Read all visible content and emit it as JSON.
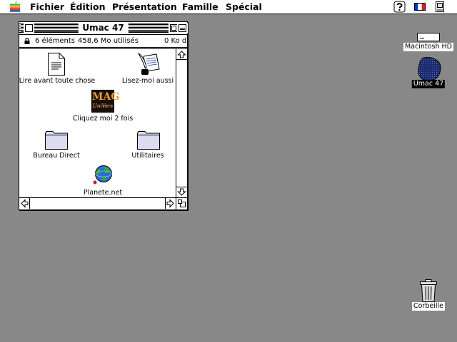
{
  "menubar": {
    "items": [
      {
        "label": "Fichier"
      },
      {
        "label": "Édition"
      },
      {
        "label": "Présentation"
      },
      {
        "label": "Famille"
      },
      {
        "label": "Spécial"
      }
    ],
    "icons": [
      "apple-icon",
      "help-icon",
      "french-flag-icon",
      "application-icon"
    ]
  },
  "window": {
    "title": "Umac 47",
    "info": {
      "items": "6 éléments",
      "used": "458,6 Mo utilisés",
      "available": "0  Ko d"
    },
    "icons": [
      {
        "label": "Lire avant toute chose",
        "icon": "document-icon"
      },
      {
        "label": "Lisez-moi aussi",
        "icon": "quill-document-icon"
      },
      {
        "label": "Cliquez moi 2 fois",
        "icon": "mag-universe-icon",
        "badge_top": "MAG",
        "badge_bottom": "UniVers"
      },
      {
        "label": "Bureau Direct",
        "icon": "folder-icon"
      },
      {
        "label": "Utilitaires",
        "icon": "folder-icon"
      },
      {
        "label": "Planete.net",
        "icon": "globe-icon"
      }
    ]
  },
  "desktop": {
    "icons": [
      {
        "label": "Macintosh HD",
        "icon": "hard-drive-icon"
      },
      {
        "label": "Umac 47",
        "icon": "disk-icon",
        "selected": true
      },
      {
        "label": "Corbeille",
        "icon": "trash-icon"
      }
    ]
  },
  "colors": {
    "desktop": "#888888",
    "disk_selected": "#1a2a6e"
  }
}
